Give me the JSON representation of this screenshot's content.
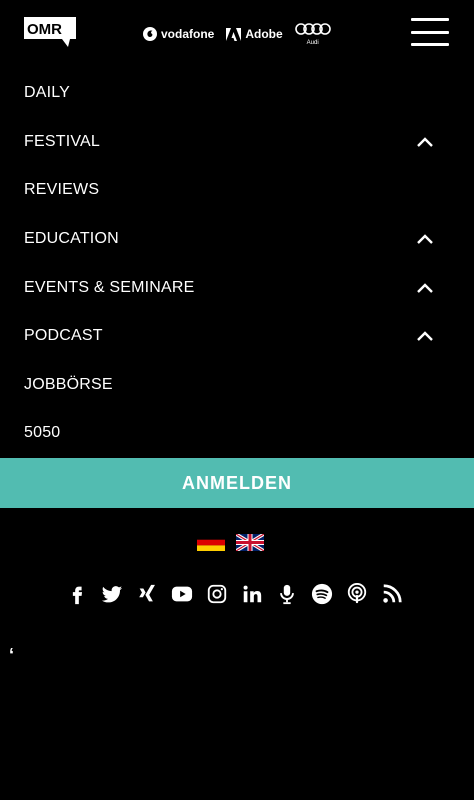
{
  "header": {
    "logo_text": "OMR",
    "sponsors": [
      "vodafone",
      "Adobe",
      "Audi"
    ]
  },
  "nav": {
    "items": [
      {
        "label": "DAILY",
        "expandable": false
      },
      {
        "label": "FESTIVAL",
        "expandable": true
      },
      {
        "label": "REVIEWS",
        "expandable": false
      },
      {
        "label": "EDUCATION",
        "expandable": true
      },
      {
        "label": "EVENTS & SEMINARE",
        "expandable": true
      },
      {
        "label": "PODCAST",
        "expandable": true
      },
      {
        "label": "JOBBÖRSE",
        "expandable": false
      },
      {
        "label": "5050",
        "expandable": false
      }
    ]
  },
  "cta": {
    "label": "ANMELDEN",
    "color": "#52bcb1"
  },
  "languages": [
    "german-flag",
    "uk-flag"
  ],
  "social": [
    "facebook-icon",
    "twitter-icon",
    "xing-icon",
    "youtube-icon",
    "instagram-icon",
    "linkedin-icon",
    "microphone-icon",
    "spotify-icon",
    "podcast-icon",
    "rss-icon"
  ],
  "footer": {
    "quote_mark": "‘"
  }
}
